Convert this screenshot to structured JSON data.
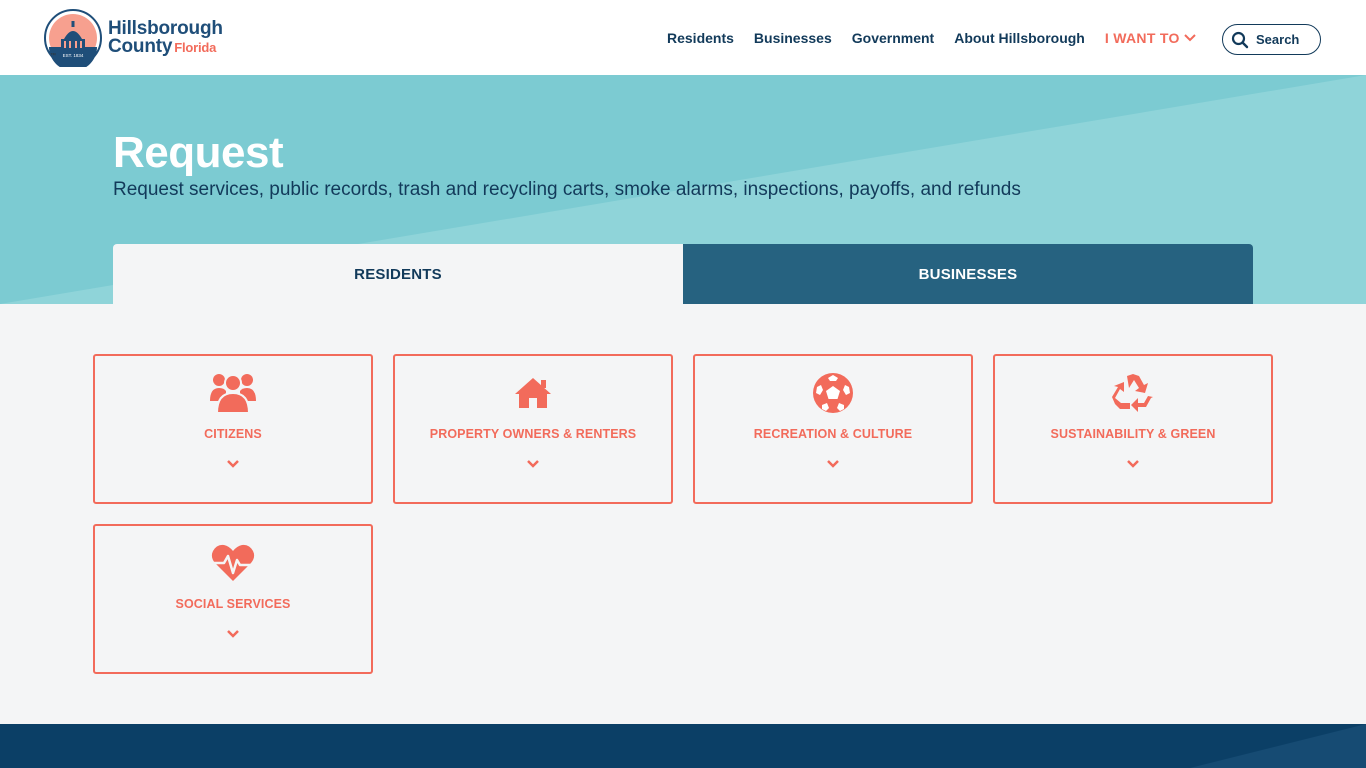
{
  "header": {
    "logo": {
      "line1": "Hillsborough",
      "line2": "County",
      "state": "Florida",
      "seal_text": "EST. 1834",
      "tm": "™"
    },
    "nav": [
      {
        "label": "Residents"
      },
      {
        "label": "Businesses"
      },
      {
        "label": "Government"
      },
      {
        "label": "About Hillsborough"
      }
    ],
    "i_want_to": "I WANT TO",
    "search_label": "Search"
  },
  "hero": {
    "title": "Request",
    "subtitle": "Request services, public records, trash and recycling carts, smoke alarms, inspections, payoffs, and refunds"
  },
  "tabs": [
    {
      "label": "RESIDENTS",
      "active": true
    },
    {
      "label": "BUSINESSES",
      "active": false
    }
  ],
  "cards": [
    {
      "label": "CITIZENS",
      "icon": "users-icon"
    },
    {
      "label": "PROPERTY OWNERS & RENTERS",
      "icon": "house-icon"
    },
    {
      "label": "RECREATION & CULTURE",
      "icon": "soccer-ball-icon"
    },
    {
      "label": "SUSTAINABILITY & GREEN",
      "icon": "recycle-icon"
    },
    {
      "label": "SOCIAL SERVICES",
      "icon": "heartbeat-icon"
    }
  ],
  "colors": {
    "accent": "#f26b5b",
    "navy": "#123a5a",
    "hero_bg": "#7ccbd2",
    "tab_inactive": "#266280",
    "footer": "#0b3f66"
  }
}
